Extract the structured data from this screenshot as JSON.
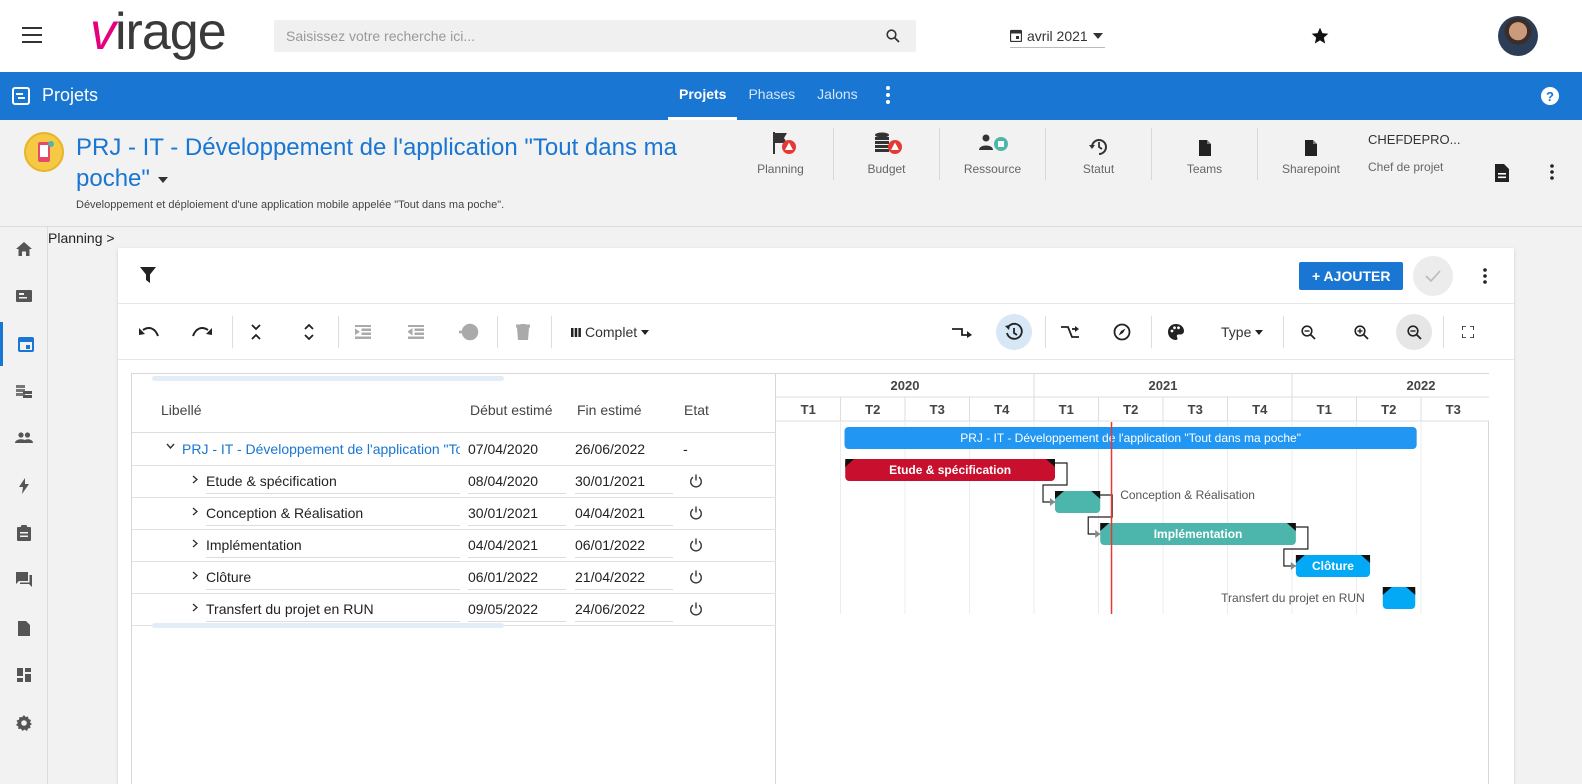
{
  "topbar": {
    "logo_accent": "v",
    "logo_rest": "irage",
    "search_placeholder": "Saisissez votre recherche ici...",
    "date": "avril 2021"
  },
  "module": {
    "title": "Projets",
    "tabs": [
      {
        "label": "Projets",
        "active": true
      },
      {
        "label": "Phases",
        "active": false
      },
      {
        "label": "Jalons",
        "active": false
      }
    ]
  },
  "project": {
    "title": "PRJ - IT - Développement de l'application \"Tout dans ma poche\"",
    "description": "Développement et déploiement d'une application mobile appelée \"Tout dans ma poche\".",
    "kpis": [
      {
        "label": "Planning",
        "icon": "flag-alert-icon"
      },
      {
        "label": "Budget",
        "icon": "coins-alert-icon"
      },
      {
        "label": "Ressource",
        "icon": "people-status-icon"
      },
      {
        "label": "Statut",
        "icon": "history-icon"
      },
      {
        "label": "Teams",
        "icon": "file-icon"
      },
      {
        "label": "Sharepoint",
        "icon": "file-icon"
      }
    ],
    "chef_name": "CHEFDEPRO...",
    "chef_role": "Chef de projet"
  },
  "breadcrumb": "Planning >",
  "actions": {
    "add_label": "+ AJOUTER",
    "view_mode": "Complet",
    "type_label": "Type"
  },
  "grid": {
    "columns": {
      "label": "Libellé",
      "start": "Début estimé",
      "end": "Fin estimé",
      "status": "Etat"
    },
    "rows": [
      {
        "label": "PRJ - IT - Développement de l'application \"Tout dans ma poche\"",
        "start": "07/04/2020",
        "end": "26/06/2022",
        "status": "-",
        "level": 0
      },
      {
        "label": "Etude & spécification",
        "start": "08/04/2020",
        "end": "30/01/2021",
        "status": "power",
        "level": 1
      },
      {
        "label": "Conception & Réalisation",
        "start": "30/01/2021",
        "end": "04/04/2021",
        "status": "power",
        "level": 1
      },
      {
        "label": "Implémentation",
        "start": "04/04/2021",
        "end": "06/01/2022",
        "status": "power",
        "level": 1
      },
      {
        "label": "Clôture",
        "start": "06/01/2022",
        "end": "21/04/2022",
        "status": "power",
        "level": 1
      },
      {
        "label": "Transfert du projet en RUN",
        "start": "09/05/2022",
        "end": "24/06/2022",
        "status": "power",
        "level": 1
      }
    ]
  },
  "gantt": {
    "years": [
      "2020",
      "2021",
      "2022"
    ],
    "quarters": [
      "T1",
      "T2",
      "T3",
      "T4",
      "T1",
      "T2",
      "T3",
      "T4",
      "T1",
      "T2",
      "T3"
    ],
    "timeline_start": "2020-01-01",
    "today": "2021-04-20",
    "bars": [
      {
        "label": "PRJ - IT - Développement de l'application \"Tout dans ma poche\"",
        "start": "2020-04-07",
        "end": "2022-06-26",
        "color": "#2196f3",
        "label_inside": true,
        "corners": false
      },
      {
        "label": "Etude & spécification",
        "start": "2020-04-08",
        "end": "2021-01-30",
        "color": "#c8102e",
        "label_inside": true,
        "corners": true
      },
      {
        "label": "Conception & Réalisation",
        "start": "2021-01-30",
        "end": "2021-04-04",
        "color": "#4db6ac",
        "label_inside": false,
        "corners": true
      },
      {
        "label": "Implémentation",
        "start": "2021-04-04",
        "end": "2022-01-06",
        "color": "#4db6ac",
        "label_inside": true,
        "corners": true
      },
      {
        "label": "Clôture",
        "start": "2022-01-06",
        "end": "2022-04-21",
        "color": "#03a9f4",
        "label_inside": true,
        "corners": true
      },
      {
        "label": "Transfert du projet en RUN",
        "start": "2022-05-09",
        "end": "2022-06-24",
        "color": "#03a9f4",
        "label_inside": false,
        "corners": true
      }
    ]
  },
  "colors": {
    "primary": "#1976d2",
    "alert": "#e53935",
    "today_line": "#e53935"
  }
}
